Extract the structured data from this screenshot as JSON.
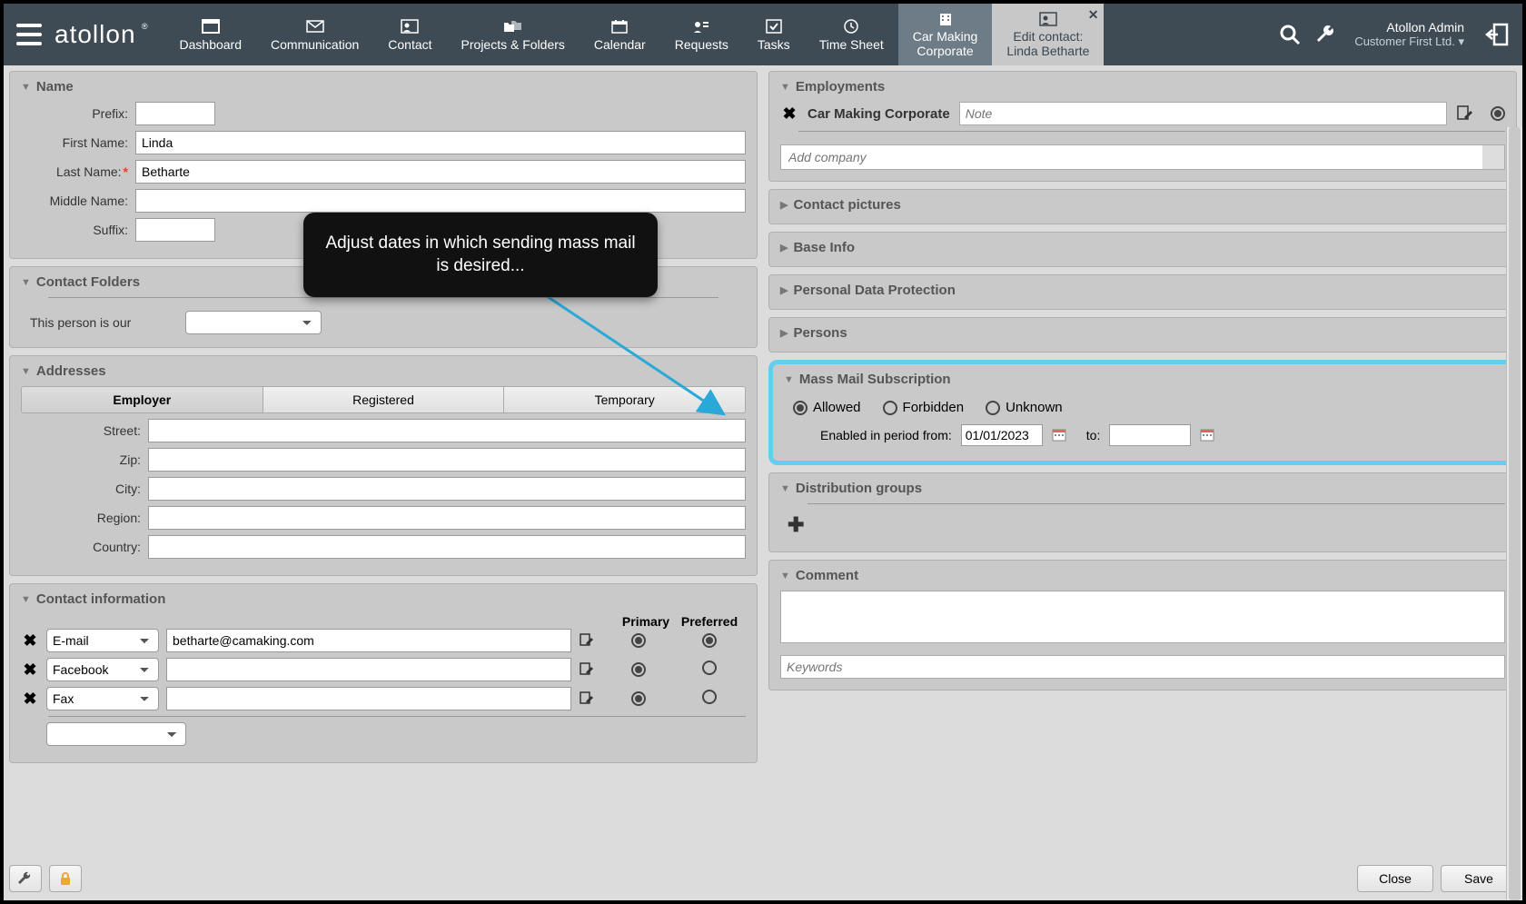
{
  "brand": "atollon",
  "nav": [
    {
      "label": "Dashboard"
    },
    {
      "label": "Communication"
    },
    {
      "label": "Contact"
    },
    {
      "label": "Projects & Folders"
    },
    {
      "label": "Calendar"
    },
    {
      "label": "Requests"
    },
    {
      "label": "Tasks"
    },
    {
      "label": "Time Sheet"
    }
  ],
  "activeTab": {
    "line1": "Car Making",
    "line2": "Corporate"
  },
  "editTab": {
    "line1": "Edit contact:",
    "line2": "Linda Betharte"
  },
  "user": {
    "name": "Atollon Admin",
    "org": "Customer First Ltd."
  },
  "left": {
    "name": {
      "title": "Name",
      "labels": {
        "prefix": "Prefix:",
        "first": "First Name:",
        "last": "Last Name:",
        "middle": "Middle Name:",
        "suffix": "Suffix:"
      },
      "values": {
        "prefix": "",
        "first": "Linda",
        "last": "Betharte",
        "middle": "",
        "suffix": ""
      }
    },
    "folders": {
      "title": "Contact Folders",
      "thisPerson": "This person is our",
      "selected": ""
    },
    "addresses": {
      "title": "Addresses",
      "tabs": [
        "Employer",
        "Registered",
        "Temporary"
      ],
      "labels": {
        "street": "Street:",
        "zip": "Zip:",
        "city": "City:",
        "region": "Region:",
        "country": "Country:"
      },
      "values": {
        "street": "",
        "zip": "",
        "city": "",
        "region": "",
        "country": ""
      }
    },
    "contactInfo": {
      "title": "Contact information",
      "cols": {
        "primary": "Primary",
        "preferred": "Preferred"
      },
      "rows": [
        {
          "type": "E-mail",
          "value": "betharte@camaking.com",
          "primary": true,
          "preferred": true
        },
        {
          "type": "Facebook",
          "value": "",
          "primary": true,
          "preferred": false
        },
        {
          "type": "Fax",
          "value": "",
          "primary": true,
          "preferred": false
        }
      ],
      "addTypePlaceholder": ""
    }
  },
  "right": {
    "employments": {
      "title": "Employments",
      "company": "Car Making Corporate",
      "notePlaceholder": "Note",
      "addPlaceholder": "Add company"
    },
    "pictures": {
      "title": "Contact pictures"
    },
    "baseInfo": {
      "title": "Base Info"
    },
    "pdp": {
      "title": "Personal Data Protection"
    },
    "persons": {
      "title": "Persons"
    },
    "massMail": {
      "title": "Mass Mail Subscription",
      "options": [
        "Allowed",
        "Forbidden",
        "Unknown"
      ],
      "selected": "Allowed",
      "periodLabel": "Enabled in period from:",
      "toLabel": "to:",
      "from": "01/01/2023",
      "to": ""
    },
    "dist": {
      "title": "Distribution groups"
    },
    "comment": {
      "title": "Comment",
      "keywordsPlaceholder": "Keywords"
    }
  },
  "footer": {
    "close": "Close",
    "save": "Save"
  },
  "callout": "Adjust dates in which sending mass mail is desired..."
}
